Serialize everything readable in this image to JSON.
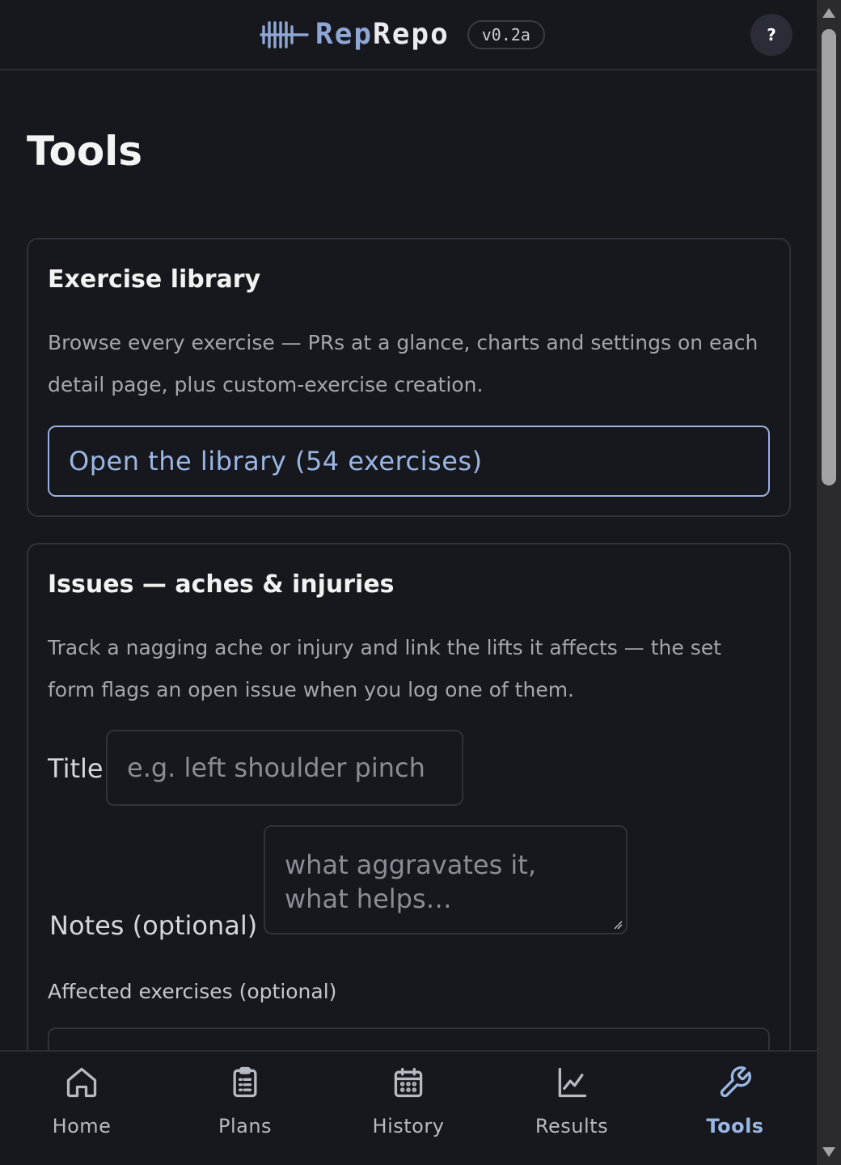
{
  "header": {
    "brand_part1": "Rep",
    "brand_part2": "Repo",
    "version": "v0.2a",
    "help_label": "?",
    "logo_icon": "barbell-logo-icon"
  },
  "page": {
    "title": "Tools"
  },
  "library_card": {
    "title": "Exercise library",
    "description": "Browse every exercise — PRs at a glance, charts and settings on each detail page, plus custom-exercise creation.",
    "button_label": "Open the library (54 exercises)"
  },
  "issues_card": {
    "title": "Issues — aches & injuries",
    "description": "Track a nagging ache or injury and link the lifts it affects — the set form flags an open issue when you log one of them.",
    "title_label": "Title",
    "title_placeholder": "e.g. left shoulder pinch",
    "notes_label": "Notes (optional)",
    "notes_placeholder": "what aggravates it,\nwhat helps…",
    "affected_label": "Affected exercises (optional)"
  },
  "nav": {
    "items": [
      {
        "label": "Home",
        "icon": "home-icon",
        "active": false
      },
      {
        "label": "Plans",
        "icon": "clipboard-icon",
        "active": false
      },
      {
        "label": "History",
        "icon": "calendar-icon",
        "active": false
      },
      {
        "label": "Results",
        "icon": "chart-icon",
        "active": false
      },
      {
        "label": "Tools",
        "icon": "wrench-icon",
        "active": true
      }
    ]
  },
  "colors": {
    "background": "#17181d",
    "accent": "#9ab6e4",
    "border": "#30323a",
    "muted_text": "#a3a6ad"
  }
}
